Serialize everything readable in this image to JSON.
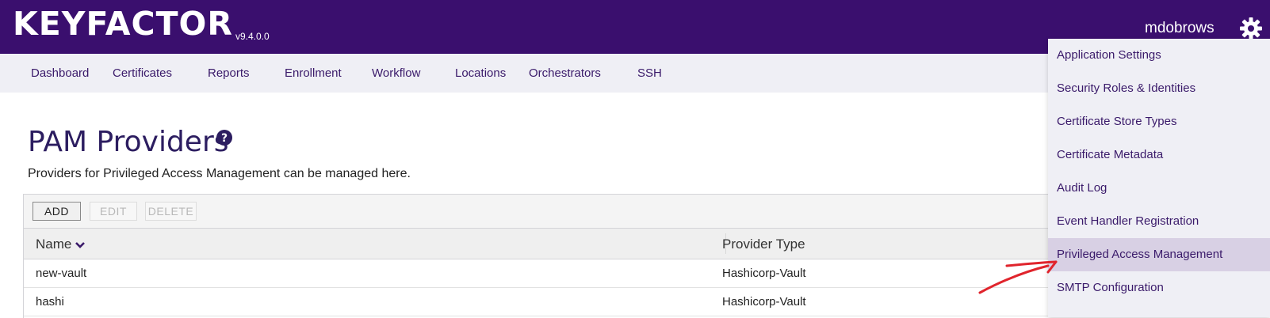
{
  "header": {
    "logo": "KEYFACTOR",
    "version": "v9.4.0.0",
    "username": "mdobrows",
    "settings_icon": "gear-icon",
    "background": "#3a0f6e"
  },
  "nav": {
    "items": [
      "Dashboard",
      "Certificates",
      "Reports",
      "Enrollment",
      "Workflow",
      "Locations",
      "Orchestrators",
      "SSH"
    ]
  },
  "page": {
    "title": "PAM Providers",
    "help_icon": "question-circle-icon",
    "subtitle": "Providers for Privileged Access Management can be managed here."
  },
  "toolbar": {
    "add_label": "ADD",
    "edit_label": "EDIT",
    "delete_label": "DELETE"
  },
  "table": {
    "columns": [
      "Name",
      "Provider Type"
    ],
    "sorted_column": "Name",
    "sort_direction": "descending",
    "rows": [
      {
        "name": "new-vault",
        "provider_type": "Hashicorp-Vault"
      },
      {
        "name": "hashi",
        "provider_type": "Hashicorp-Vault"
      }
    ]
  },
  "settings_menu": {
    "items": [
      "Application Settings",
      "Security Roles & Identities",
      "Certificate Store Types",
      "Certificate Metadata",
      "Audit Log",
      "Event Handler Registration",
      "Privileged Access Management",
      "SMTP Configuration"
    ],
    "highlighted": "Privileged Access Management",
    "highlight_color": "#d8d0e4"
  },
  "annotation": {
    "arrow_color": "#e0242c"
  }
}
